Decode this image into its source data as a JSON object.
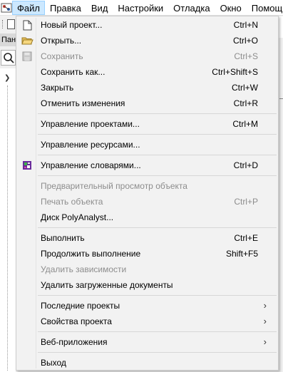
{
  "menubar": {
    "items": [
      {
        "label": "Файл",
        "active": true
      },
      {
        "label": "Правка",
        "active": false
      },
      {
        "label": "Вид",
        "active": false
      },
      {
        "label": "Настройки",
        "active": false
      },
      {
        "label": "Отладка",
        "active": false
      },
      {
        "label": "Окно",
        "active": false
      },
      {
        "label": "Помощь",
        "active": false
      }
    ]
  },
  "background": {
    "panel_tab_label": "Пан"
  },
  "file_menu": {
    "new_project": {
      "label": "Новый проект...",
      "shortcut": "Ctrl+N",
      "icon": "new-document-icon"
    },
    "open": {
      "label": "Открыть...",
      "shortcut": "Ctrl+O",
      "icon": "open-folder-icon"
    },
    "save": {
      "label": "Сохранить",
      "shortcut": "Ctrl+S",
      "icon": "save-disk-icon",
      "disabled": true
    },
    "save_as": {
      "label": "Сохранить как...",
      "shortcut": "Ctrl+Shift+S"
    },
    "close": {
      "label": "Закрыть",
      "shortcut": "Ctrl+W"
    },
    "undo_changes": {
      "label": "Отменить изменения",
      "shortcut": "Ctrl+R"
    },
    "manage_projects": {
      "label": "Управление проектами...",
      "shortcut": "Ctrl+M"
    },
    "manage_resources": {
      "label": "Управление ресурсами..."
    },
    "manage_dictionaries": {
      "label": "Управление словарями...",
      "shortcut": "Ctrl+D",
      "icon": "dictionary-icon"
    },
    "object_preview": {
      "label": "Предварительный просмотр объекта",
      "disabled": true
    },
    "print_object": {
      "label": "Печать объекта",
      "shortcut": "Ctrl+P",
      "disabled": true
    },
    "polyanalyst_disk": {
      "label": "Диск PolyAnalyst..."
    },
    "execute": {
      "label": "Выполнить",
      "shortcut": "Ctrl+E"
    },
    "continue_execution": {
      "label": "Продолжить выполнение",
      "shortcut": "Shift+F5"
    },
    "delete_dependencies": {
      "label": "Удалить зависимости",
      "disabled": true
    },
    "delete_loaded_docs": {
      "label": "Удалить загруженные документы"
    },
    "recent_projects": {
      "label": "Последние проекты",
      "submenu": true
    },
    "project_properties": {
      "label": "Свойства проекта",
      "submenu": true
    },
    "web_apps": {
      "label": "Веб-приложения",
      "submenu": true
    },
    "exit": {
      "label": "Выход"
    }
  },
  "colors": {
    "menu_background": "#f2f2f2",
    "active_menubar_bg": "#cce8ff",
    "active_menubar_border": "#99d1ff",
    "disabled_text": "#8d8d8d"
  }
}
